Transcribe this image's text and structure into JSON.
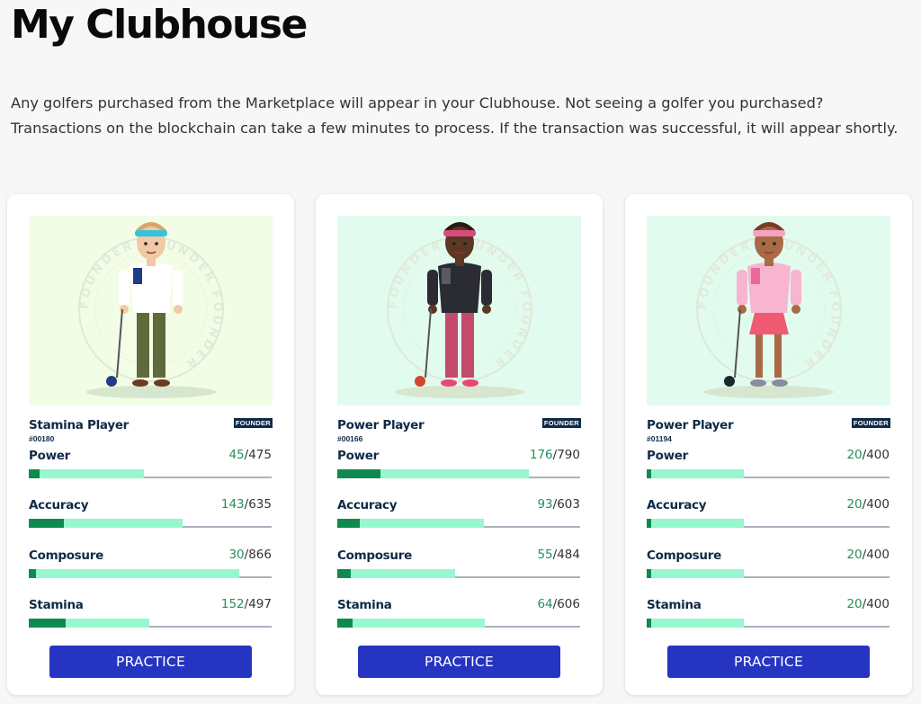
{
  "page": {
    "title": "My Clubhouse",
    "intro": "Any golfers purchased from the Marketplace will appear in your Clubhouse. Not seeing a golfer you purchased? Transactions on the blockchain can take a few minutes to process. If the transaction was successful, it will appear shortly."
  },
  "colors": {
    "button": "#2634c2",
    "bar_current": "#0f8a4f",
    "bar_potential": "#97f7cf",
    "stat_current_text": "#23915a"
  },
  "golfers": [
    {
      "type": "Stamina Player",
      "number": "#00180",
      "badge": "FOUNDER",
      "art_bg": "#f3fde6",
      "art_watermark": "FOUNDER",
      "stats": [
        {
          "label": "Power",
          "current": "45",
          "max": "475"
        },
        {
          "label": "Accuracy",
          "current": "143",
          "max": "635"
        },
        {
          "label": "Composure",
          "current": "30",
          "max": "866"
        },
        {
          "label": "Stamina",
          "current": "152",
          "max": "497"
        }
      ],
      "button": "PRACTICE"
    },
    {
      "type": "Power Player",
      "number": "#00166",
      "badge": "FOUNDER",
      "art_bg": "#e2fbef",
      "art_watermark": "FOUNDER",
      "stats": [
        {
          "label": "Power",
          "current": "176",
          "max": "790"
        },
        {
          "label": "Accuracy",
          "current": "93",
          "max": "603"
        },
        {
          "label": "Composure",
          "current": "55",
          "max": "484"
        },
        {
          "label": "Stamina",
          "current": "64",
          "max": "606"
        }
      ],
      "button": "PRACTICE"
    },
    {
      "type": "Power Player",
      "number": "#01194",
      "badge": "FOUNDER",
      "art_bg": "#e2fbef",
      "art_watermark": "FOUNDER",
      "stats": [
        {
          "label": "Power",
          "current": "20",
          "max": "400"
        },
        {
          "label": "Accuracy",
          "current": "20",
          "max": "400"
        },
        {
          "label": "Composure",
          "current": "20",
          "max": "400"
        },
        {
          "label": "Stamina",
          "current": "20",
          "max": "400"
        }
      ],
      "button": "PRACTICE"
    }
  ]
}
